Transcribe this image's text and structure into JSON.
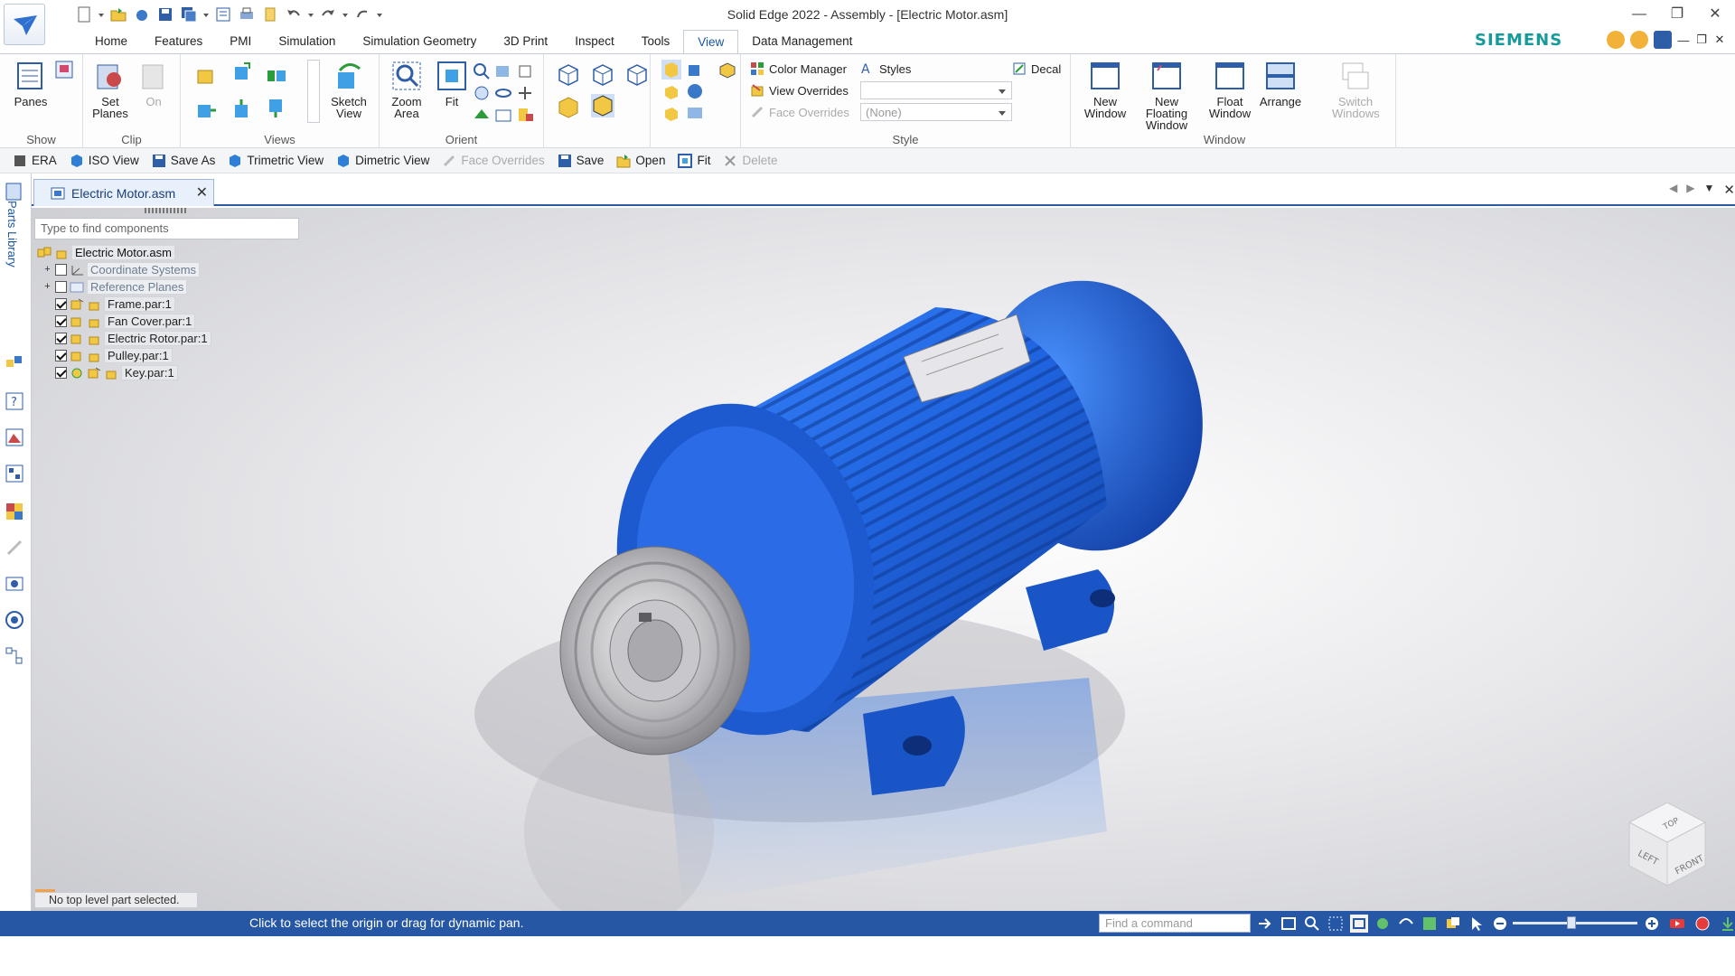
{
  "window": {
    "title": "Solid Edge 2022 - Assembly - [Electric Motor.asm]",
    "brand": "SIEMENS",
    "brand_color": "#159b9c"
  },
  "ribbon_tabs": [
    "Home",
    "Features",
    "PMI",
    "Simulation",
    "Simulation Geometry",
    "3D Print",
    "Inspect",
    "Tools",
    "View",
    "Data Management"
  ],
  "active_tab": "View",
  "ribbon": {
    "show": {
      "label": "Show",
      "panes": "Panes"
    },
    "clip": {
      "label": "Clip",
      "set_planes": "Set Planes",
      "on": "On"
    },
    "views": {
      "label": "Views",
      "sketch_view": "Sketch View"
    },
    "orient": {
      "label": "Orient",
      "zoom_area": "Zoom Area",
      "fit": "Fit"
    },
    "style": {
      "label": "Style",
      "color_manager": "Color Manager",
      "styles": "Styles",
      "view_overrides": "View Overrides",
      "face_overrides": "Face Overrides",
      "face_overrides_value": "(None)",
      "decal": "Decal"
    },
    "window": {
      "label": "Window",
      "new_window": "New Window",
      "new_floating_window": "New Floating Window",
      "float_window": "Float Window",
      "arrange": "Arrange",
      "switch_windows": "Switch Windows"
    }
  },
  "command_bar": {
    "era": "ERA",
    "iso_view": "ISO View",
    "save_as": "Save As",
    "trimetric_view": "Trimetric View",
    "dimetric_view": "Dimetric View",
    "face_overrides": "Face Overrides",
    "save": "Save",
    "open": "Open",
    "fit": "Fit",
    "delete": "Delete"
  },
  "document_tab": "Electric Motor.asm",
  "side_panel_label": "Parts Library",
  "tree": {
    "search_placeholder": "Type to find components",
    "root": "Electric Motor.asm",
    "items": [
      {
        "label": "Coordinate Systems",
        "checked": false,
        "expandable": true
      },
      {
        "label": "Reference Planes",
        "checked": false,
        "expandable": true
      },
      {
        "label": "Frame.par:1",
        "checked": true
      },
      {
        "label": "Fan Cover.par:1",
        "checked": true
      },
      {
        "label": "Electric Rotor.par:1",
        "checked": true
      },
      {
        "label": "Pulley.par:1",
        "checked": true
      },
      {
        "label": "Key.par:1",
        "checked": true
      }
    ]
  },
  "viewport_status": "No top level part selected.",
  "view_cube": {
    "top": "TOP",
    "left": "LEFT",
    "front": "FRONT"
  },
  "status_bar": {
    "prompt": "Click to select the origin or drag for dynamic pan.",
    "find_command_placeholder": "Find a command",
    "color": "#2557a5"
  },
  "colors": {
    "accent": "#1a56a5",
    "motor_blue": "#1f5fd6"
  }
}
